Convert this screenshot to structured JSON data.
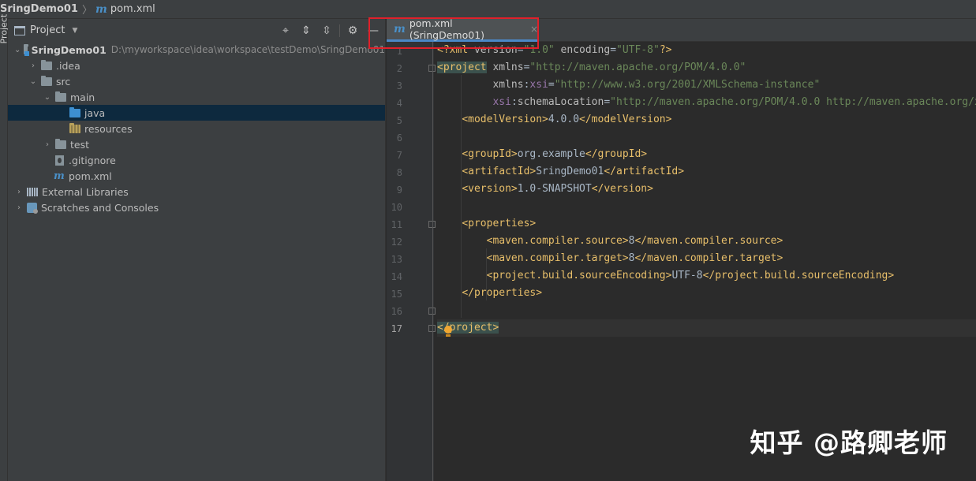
{
  "breadcrumb": {
    "project": "SringDemo01",
    "separator": "〉",
    "file_icon": "m",
    "file": "pom.xml"
  },
  "left_strip": {
    "label": "Project"
  },
  "project_panel": {
    "title": "Project",
    "tools": {
      "locate": "⌖",
      "expand": "⇕",
      "collapse": "⇳",
      "settings": "⚙",
      "hide": "—"
    },
    "tree": [
      {
        "label": "SringDemo01",
        "path": "D:\\myworkspace\\idea\\workspace\\testDemo\\SringDemo01"
      },
      {
        "label": ".idea"
      },
      {
        "label": "src"
      },
      {
        "label": "main"
      },
      {
        "label": "java"
      },
      {
        "label": "resources"
      },
      {
        "label": "test"
      },
      {
        "label": ".gitignore"
      },
      {
        "label": "pom.xml",
        "icon": "m"
      },
      {
        "label": "External Libraries"
      },
      {
        "label": "Scratches and Consoles"
      }
    ]
  },
  "editor": {
    "tab": {
      "icon": "m",
      "label": "pom.xml (SringDemo01)",
      "close": "×"
    },
    "line_numbers": [
      "1",
      "2",
      "3",
      "4",
      "5",
      "6",
      "7",
      "8",
      "9",
      "10",
      "11",
      "12",
      "13",
      "14",
      "15",
      "16",
      "17"
    ]
  },
  "colors": {
    "accent": "#4a88c7",
    "highlight_box": "#e0202a",
    "tag": "#e8bf6a",
    "string": "#6a8759",
    "namespace": "#9876aa"
  },
  "watermark": "知乎 @路卿老师"
}
